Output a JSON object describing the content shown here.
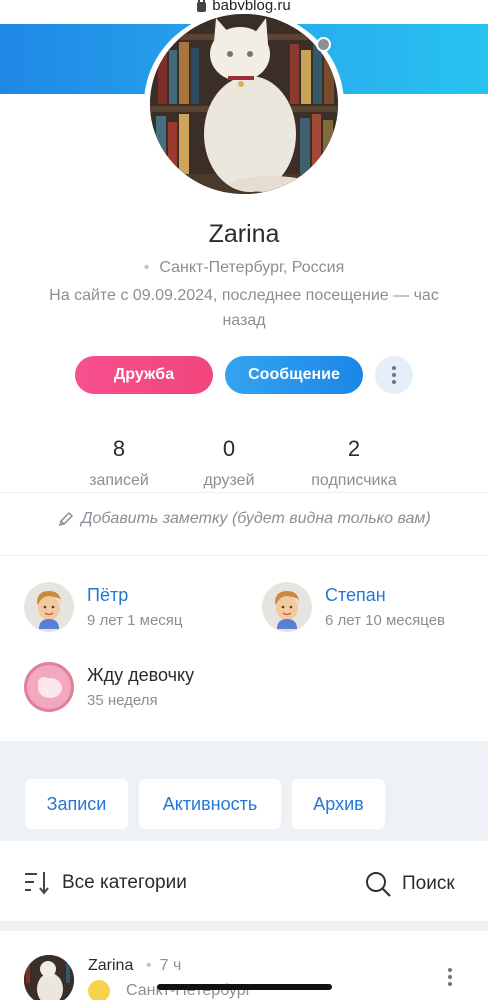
{
  "browser": {
    "url": "babyblog.ru"
  },
  "profile": {
    "name": "Zarina",
    "location": "Санкт-Петербург, Россия",
    "since_line": "На сайте с 09.09.2024, последнее посещение — час назад"
  },
  "actions": {
    "friend_label": "Дружба",
    "message_label": "Сообщение"
  },
  "stats": [
    {
      "value": "8",
      "label": "записей"
    },
    {
      "value": "0",
      "label": "друзей"
    },
    {
      "value": "2",
      "label": "подписчика"
    }
  ],
  "note_text": "Добавить заметку (будет видна только вам)",
  "children": [
    {
      "name": "Пётр",
      "age": "9 лет 1 месяц"
    },
    {
      "name": "Степан",
      "age": "6 лет 10 месяцев"
    }
  ],
  "pregnancy": {
    "title": "Жду девочку",
    "week": "35 неделя"
  },
  "tabs": [
    "Записи",
    "Активность",
    "Архив"
  ],
  "filter": {
    "categories_label": "Все категории",
    "search_label": "Поиск"
  },
  "post": {
    "author": "Zarina",
    "time": "7 ч",
    "city": "Санкт-Петербург"
  },
  "colors": {
    "banner": "#1e88e5",
    "friend": "#f2457c",
    "message": "#1c86e8",
    "link": "#2477d6"
  }
}
